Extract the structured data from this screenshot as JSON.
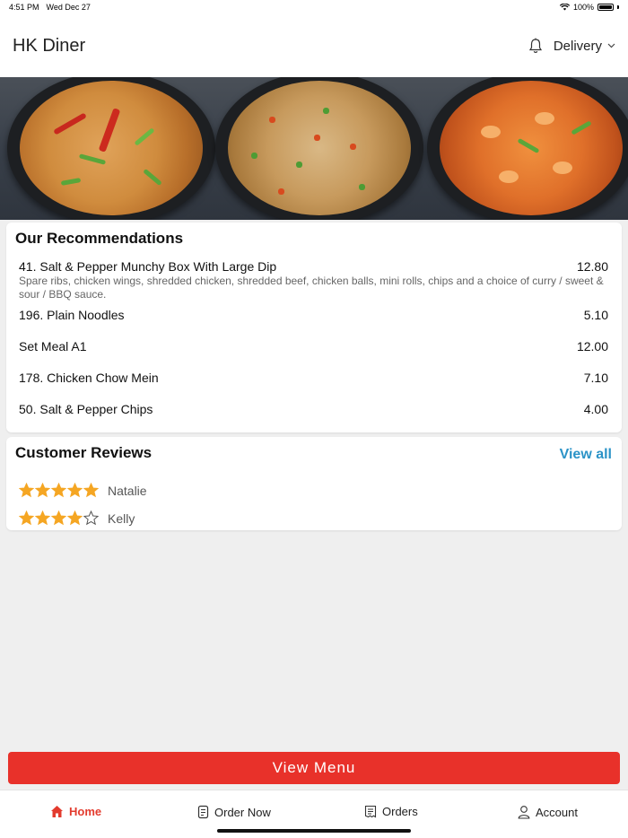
{
  "status_bar": {
    "time": "4:51 PM",
    "date": "Wed Dec 27",
    "battery": "100%"
  },
  "header": {
    "title": "HK Diner",
    "mode_label": "Delivery"
  },
  "recommendations": {
    "title": "Our Recommendations",
    "items": [
      {
        "name": "41. Salt & Pepper Munchy Box With Large Dip",
        "price": "12.80",
        "description": "Spare ribs, chicken wings, shredded chicken, shredded beef, chicken balls, mini rolls, chips and a choice of curry / sweet & sour / BBQ sauce."
      },
      {
        "name": "196. Plain Noodles",
        "price": "5.10"
      },
      {
        "name": "Set Meal A1",
        "price": "12.00"
      },
      {
        "name": "178. Chicken Chow Mein",
        "price": "7.10"
      },
      {
        "name": "50. Salt & Pepper Chips",
        "price": "4.00"
      }
    ]
  },
  "reviews": {
    "title": "Customer Reviews",
    "view_all_label": "View all",
    "items": [
      {
        "name": "Natalie",
        "rating": 5,
        "max_rating": 5
      },
      {
        "name": "Kelly",
        "rating": 4,
        "max_rating": 5
      }
    ]
  },
  "view_menu_label": "View Menu",
  "tabs": [
    {
      "label": "Home",
      "icon": "home-icon",
      "active": true
    },
    {
      "label": "Order Now",
      "icon": "order-icon",
      "active": false
    },
    {
      "label": "Orders",
      "icon": "receipt-icon",
      "active": false
    },
    {
      "label": "Account",
      "icon": "person-icon",
      "active": false
    }
  ],
  "colors": {
    "accent": "#e8312a",
    "link": "#2b93c7",
    "star": "#f5a623"
  }
}
